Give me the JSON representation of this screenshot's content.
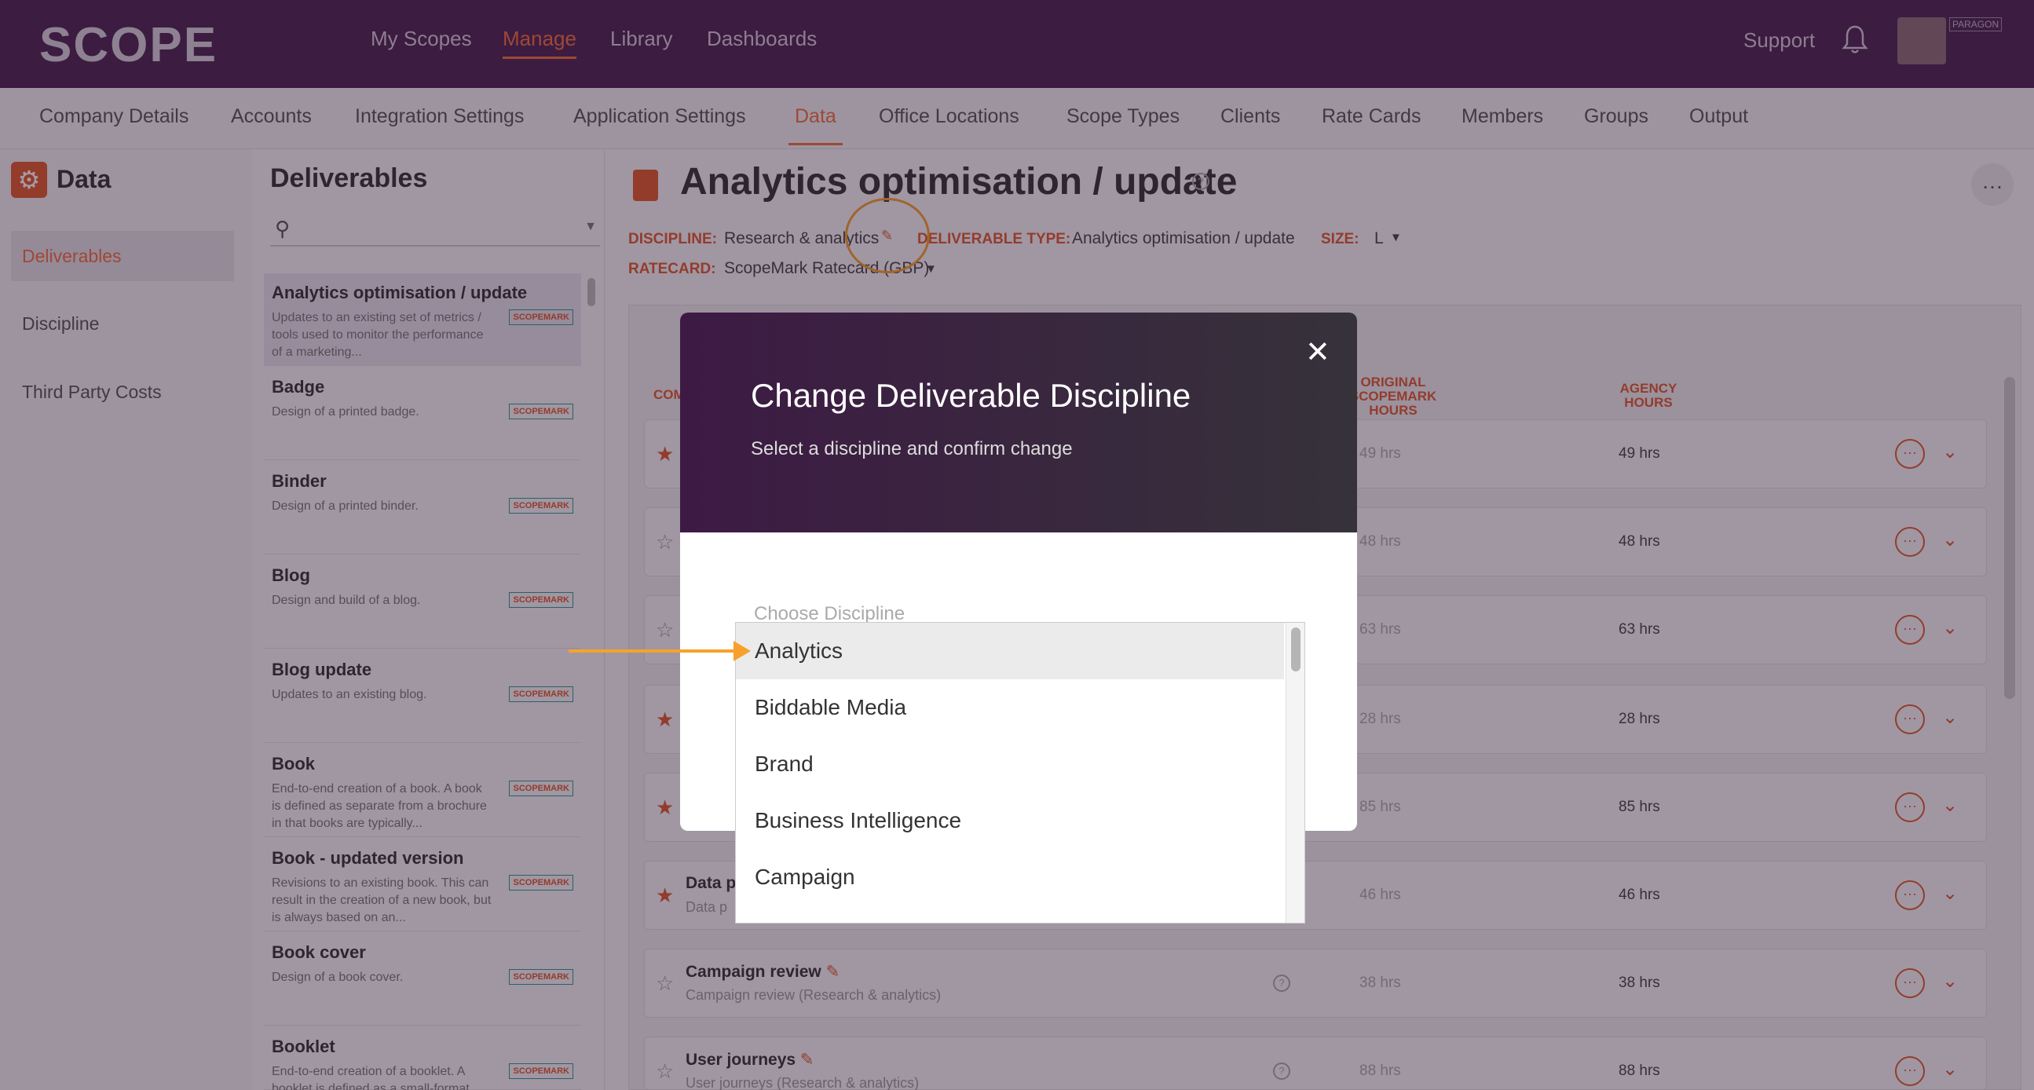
{
  "topnav": {
    "logo": "SCOPE",
    "links": [
      "My Scopes",
      "Manage",
      "Library",
      "Dashboards"
    ],
    "active": "Manage",
    "support": "Support",
    "badge": "PARAGON"
  },
  "subnav": {
    "links": [
      "Company Details",
      "Accounts",
      "Integration Settings",
      "Application Settings",
      "Data",
      "Office Locations",
      "Scope Types",
      "Clients",
      "Rate Cards",
      "Members",
      "Groups",
      "Output"
    ],
    "active": "Data"
  },
  "sidebar": {
    "title": "Data",
    "items": [
      "Deliverables",
      "Discipline",
      "Third Party Costs"
    ]
  },
  "deliverables": {
    "title": "Deliverables",
    "tag": "SCOPEMARK",
    "items": [
      {
        "name": "Analytics optimisation / update",
        "desc": "Updates to an existing set of metrics / tools used to monitor the performance of a marketing..."
      },
      {
        "name": "Badge",
        "desc": "Design of a printed badge."
      },
      {
        "name": "Binder",
        "desc": "Design of a printed binder."
      },
      {
        "name": "Blog",
        "desc": "Design and build of a blog."
      },
      {
        "name": "Blog update",
        "desc": "Updates to an existing blog."
      },
      {
        "name": "Book",
        "desc": "End-to-end creation of a book. A book is defined as separate from a brochure in that books are typically..."
      },
      {
        "name": "Book - updated version",
        "desc": "Revisions to an existing book. This can result in the creation of a new book, but is always based on an..."
      },
      {
        "name": "Book cover",
        "desc": "Design of a book cover."
      },
      {
        "name": "Booklet",
        "desc": "End-to-end creation of a booklet. A booklet is defined as a small-format"
      }
    ]
  },
  "main": {
    "title": "Analytics optimisation / update",
    "discipline_label": "DISCIPLINE:",
    "discipline_value": "Research & analytics",
    "type_label": "DELIVERABLE TYPE:",
    "type_value": "Analytics optimisation / update",
    "size_label": "SIZE:",
    "size_value": "L",
    "ratecard_label": "RATECARD:",
    "ratecard_value": "ScopeMark Ratecard (GBP)",
    "col_orig": "ORIGINAL SCOPEMARK HOURS",
    "col_agency": "AGENCY HOURS",
    "col_comp": "COM"
  },
  "rows": [
    {
      "name": "",
      "sub": "",
      "orig": "49 hrs",
      "agency": "49 hrs",
      "star": true
    },
    {
      "name": "",
      "sub": "",
      "orig": "48 hrs",
      "agency": "48 hrs",
      "star": false
    },
    {
      "name": "",
      "sub": "",
      "orig": "63 hrs",
      "agency": "63 hrs",
      "star": false
    },
    {
      "name": "",
      "sub": "",
      "orig": "28 hrs",
      "agency": "28 hrs",
      "star": true
    },
    {
      "name": "",
      "sub": "",
      "orig": "85 hrs",
      "agency": "85 hrs",
      "star": true
    },
    {
      "name": "Data p",
      "sub": "Data p",
      "orig": "46 hrs",
      "agency": "46 hrs",
      "star": true
    },
    {
      "name": "Campaign review",
      "sub": "Campaign review (Research & analytics)",
      "orig": "38 hrs",
      "agency": "38 hrs",
      "star": false
    },
    {
      "name": "User journeys",
      "sub": "User journeys (Research & analytics)",
      "orig": "88 hrs",
      "agency": "88 hrs",
      "star": false
    }
  ],
  "modal": {
    "title": "Change Deliverable Discipline",
    "subtitle": "Select a discipline and confirm change",
    "choose_label": "Choose Discipline",
    "options": [
      "Analytics",
      "Biddable Media",
      "Brand",
      "Business Intelligence",
      "Campaign"
    ],
    "selected": "Analytics"
  },
  "colors": {
    "brand_purple": "#4b2350",
    "accent_orange": "#f36f3b",
    "annotation_orange": "#f7a12c"
  }
}
